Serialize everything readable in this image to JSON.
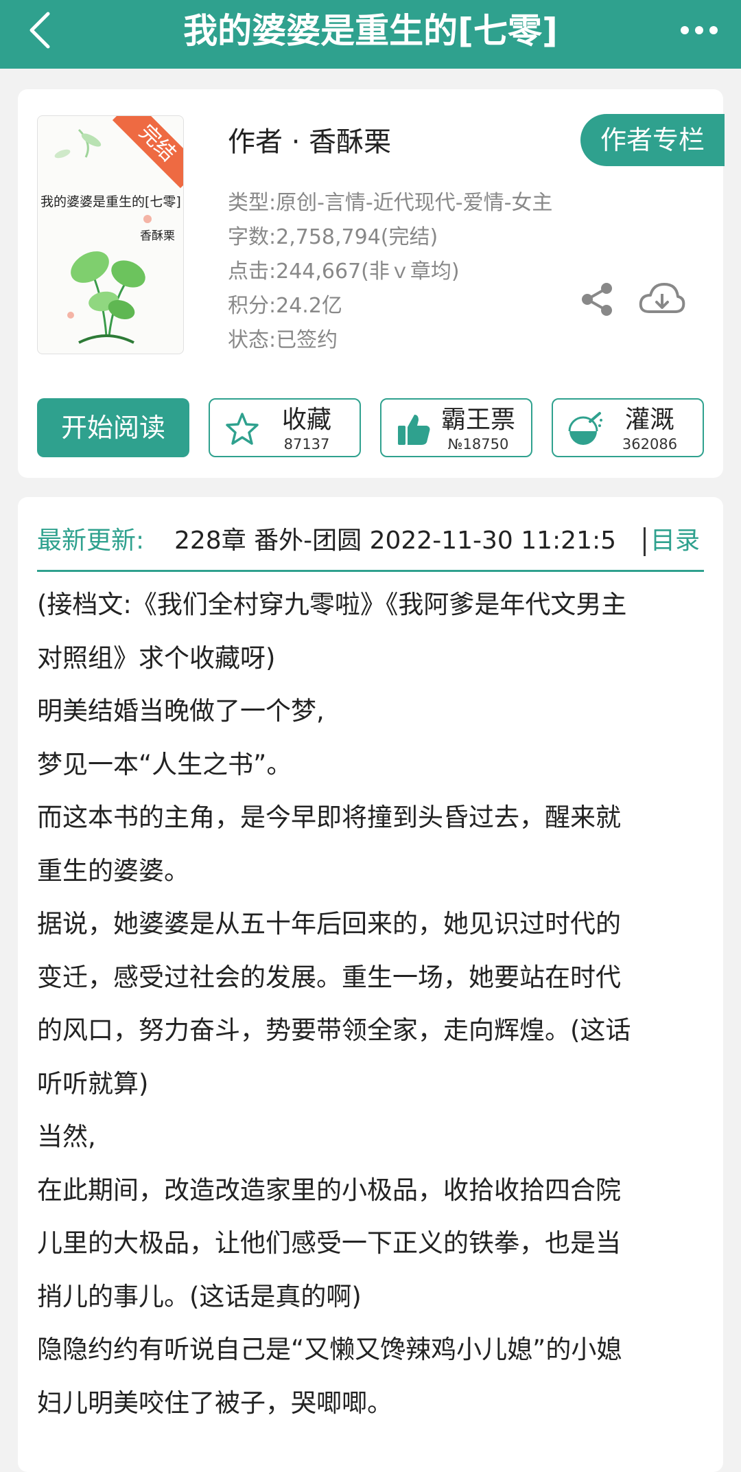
{
  "header": {
    "title": "我的婆婆是重生的[七零]",
    "back_icon": "back-arrow-icon",
    "more_icon": "more-dots-icon"
  },
  "book": {
    "cover": {
      "title": "我的婆婆是重生的[七零]",
      "author": "香酥栗",
      "ribbon": "完结"
    },
    "author_line": "作者 · 香酥栗",
    "author_column_label": "作者专栏",
    "meta": {
      "type": "类型:原创-言情-近代现代-爱情-女主",
      "words": "字数:2,758,794(完结)",
      "clicks": "点击:244,667(非ｖ章均)",
      "points": "积分:24.2亿",
      "status": "状态:已签约"
    },
    "actions": {
      "read_label": "开始阅读",
      "favorite": {
        "label": "收藏",
        "count": "87137"
      },
      "vote": {
        "label": "霸王票",
        "count": "№18750"
      },
      "water": {
        "label": "灌溉",
        "count": "362086"
      }
    }
  },
  "update": {
    "label": "最新更新:",
    "text": "228章 番外-团圆 2022-11-30 11:21:5",
    "toc_label": "目录"
  },
  "synopsis": [
    "(接档文:《我们全村穿九零啦》《我阿爹是年代文男主",
    "对照组》求个收藏呀)",
    "明美结婚当晚做了一个梦,",
    "梦见一本“人生之书”。",
    "而这本书的主角，是今早即将撞到头昏过去，醒来就",
    "重生的婆婆。",
    "据说，她婆婆是从五十年后回来的，她见识过时代的",
    "变迁，感受过社会的发展。重生一场，她要站在时代",
    "的风口，努力奋斗，势要带领全家，走向辉煌。(这话",
    "听听就算)",
    "当然,",
    "在此期间，改造改造家里的小极品，收拾收拾四合院",
    "儿里的大极品，让他们感受一下正义的铁拳，也是当",
    "捎儿的事儿。(这话是真的啊)",
    "隐隐约约有听说自己是“又懒又馋辣鸡小儿媳”的小媳",
    "妇儿明美咬住了被子，哭唧唧。"
  ],
  "colors": {
    "accent": "#2fa18e",
    "ribbon": "#ee6a42"
  }
}
